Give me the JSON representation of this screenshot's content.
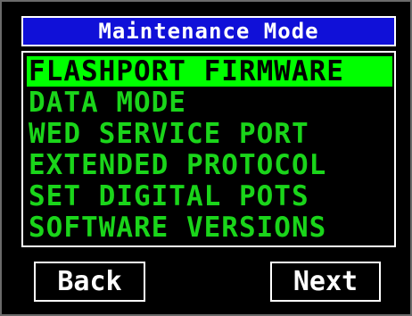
{
  "screen": {
    "title": "Maintenance Mode"
  },
  "menu": {
    "selected_index": 0,
    "items": [
      {
        "label": "FLASHPORT FIRMWARE"
      },
      {
        "label": "DATA MODE"
      },
      {
        "label": "WED SERVICE PORT"
      },
      {
        "label": "EXTENDED PROTOCOL"
      },
      {
        "label": "SET DIGITAL POTS"
      },
      {
        "label": "SOFTWARE VERSIONS"
      }
    ]
  },
  "buttons": {
    "back_label": "Back",
    "next_label": "Next"
  },
  "colors": {
    "title_bg": "#1010d8",
    "menu_text": "#1ad51a",
    "highlight_bg": "#00ff00",
    "screen_bg": "#000000"
  }
}
